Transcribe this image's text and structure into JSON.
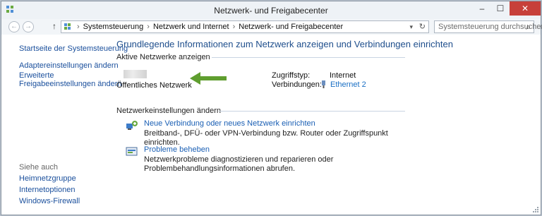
{
  "window": {
    "title": "Netzwerk- und Freigabecenter",
    "minimize_glyph": "–",
    "maximize_glyph": "☐",
    "close_glyph": "✕"
  },
  "nav": {
    "back_glyph": "←",
    "forward_glyph": "→",
    "up_glyph": "↑",
    "breadcrumbs": [
      "Systemsteuerung",
      "Netzwerk und Internet",
      "Netzwerk- und Freigabecenter"
    ],
    "separator": "›",
    "dropdown_glyph": "▾",
    "refresh_glyph": "↻",
    "search_placeholder": "Systemsteuerung durchsuchen",
    "search_glyph": "⌕"
  },
  "sidebar": {
    "links": [
      "Startseite der Systemsteuerung",
      "Adaptereinstellungen ändern",
      "Erweiterte",
      "Freigabeeinstellungen ändern"
    ],
    "see_also_label": "Siehe auch",
    "see_also": [
      "Heimnetzgruppe",
      "Internetoptionen",
      "Windows-Firewall"
    ]
  },
  "main": {
    "heading": "Grundlegende Informationen zum Netzwerk anzeigen und Verbindungen einrichten",
    "active_label": "Aktive Netzwerke anzeigen",
    "network_type": "Öffentliches Netzwerk",
    "access_type_label": "Zugriffstyp:",
    "access_type_value": "Internet",
    "connections_label": "Verbindungen:",
    "connection_name": "Ethernet 2",
    "change_label": "Netzwerkeinstellungen ändern",
    "tasks": [
      {
        "icon": "network-connection-icon",
        "title": "Neue Verbindung oder neues Netzwerk einrichten",
        "desc": "Breitband-, DFÜ- oder VPN-Verbindung bzw. Router oder Zugriffspunkt einrichten."
      },
      {
        "icon": "troubleshoot-icon",
        "title": "Probleme beheben",
        "desc": "Netzwerkprobleme diagnostizieren und reparieren oder Problembehandlungsinformationen abrufen."
      }
    ]
  },
  "colors": {
    "accent_link": "#1a5fb4",
    "heading": "#1e4e8c",
    "arrow_annotation": "#5f9e2f",
    "close_button": "#c7403a"
  }
}
